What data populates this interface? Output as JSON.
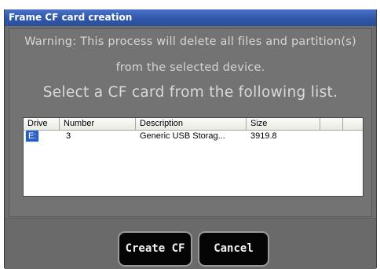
{
  "window": {
    "title": "Frame CF card creation"
  },
  "dialog": {
    "warning_line1": "Warning: This process will delete all files and partition(s)",
    "warning_line2": "from the selected device.",
    "instruction": "Select a CF card from the following list."
  },
  "device_list": {
    "columns": [
      "Drive",
      "Number",
      "Description",
      "Size",
      ""
    ],
    "rows": [
      {
        "drive": "E:",
        "number": "3",
        "description": "Generic USB Storag...",
        "size": "3919.8",
        "selected": true
      }
    ]
  },
  "buttons": {
    "create_label": "Create CF",
    "cancel_label": "Cancel"
  },
  "colors": {
    "titlebar": "#2f56a8",
    "dialog_bg": "#6e6e6e",
    "selection": "#2a5ec6",
    "button_bg": "#050505"
  }
}
